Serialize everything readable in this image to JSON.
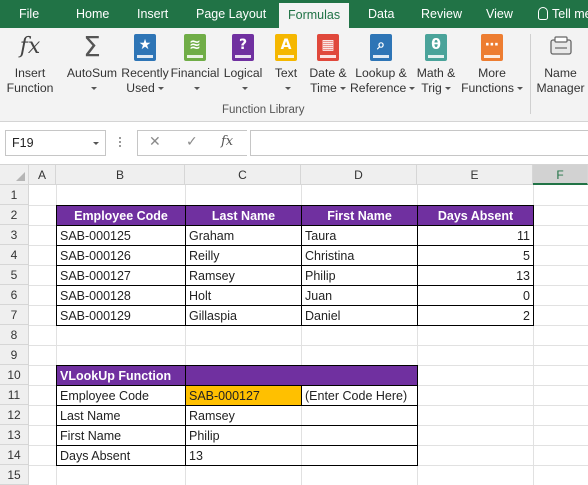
{
  "tabs": [
    "File",
    "Home",
    "Insert",
    "Page Layout",
    "Formulas",
    "Data",
    "Review",
    "View"
  ],
  "active_tab": "Formulas",
  "tell_me": "Tell me",
  "ribbon": {
    "insert_function": [
      "Insert",
      "Function"
    ],
    "autosum": "AutoSum",
    "recently_used": [
      "Recently",
      "Used"
    ],
    "financial": "Financial",
    "logical": "Logical",
    "text": "Text",
    "date_time": [
      "Date &",
      "Time"
    ],
    "lookup_reference": [
      "Lookup &",
      "Reference"
    ],
    "math_trig": [
      "Math &",
      "Trig"
    ],
    "more_functions": [
      "More",
      "Functions"
    ],
    "name_manager": [
      "Name",
      "Manager"
    ],
    "group_label": "Function Library",
    "icon_colors": {
      "recently_used": "#2e75b6",
      "financial": "#70ad47",
      "logical": "#7030a0",
      "text": "#f5b700",
      "date_time": "#e0483b",
      "lookup_reference": "#2e75b6",
      "math_trig": "#4aa39a",
      "more_functions": "#ed7d31"
    }
  },
  "formula_bar": {
    "name_box": "F19",
    "cancel_icon": "✕",
    "enter_icon": "✓",
    "fx_icon": "fx",
    "formula": ""
  },
  "columns": [
    "A",
    "B",
    "C",
    "D",
    "E",
    "F"
  ],
  "selected_column": "F",
  "rows": [
    "1",
    "2",
    "3",
    "4",
    "5",
    "6",
    "7",
    "8",
    "9",
    "10",
    "11",
    "12",
    "13",
    "14",
    "15"
  ],
  "table": {
    "headers": [
      "Employee Code",
      "Last Name",
      "First Name",
      "Days Absent"
    ],
    "rows": [
      [
        "SAB-000125",
        "Graham",
        "Taura",
        "11"
      ],
      [
        "SAB-000126",
        "Reilly",
        "Christina",
        "5"
      ],
      [
        "SAB-000127",
        "Ramsey",
        "Philip",
        "13"
      ],
      [
        "SAB-000128",
        "Holt",
        "Juan",
        "0"
      ],
      [
        "SAB-000129",
        "Gillaspia",
        "Daniel",
        "2"
      ]
    ]
  },
  "vlookup": {
    "title": "VLookUp Function",
    "labels": [
      "Employee Code",
      "Last Name",
      "First Name",
      "Days Absent"
    ],
    "values": [
      "SAB-000127",
      "Ramsey",
      "Philip",
      "13"
    ],
    "hint": "(Enter Code Here)"
  },
  "colors": {
    "excel_green": "#217346",
    "header_purple": "#7030a0",
    "input_orange": "#ffc000"
  }
}
